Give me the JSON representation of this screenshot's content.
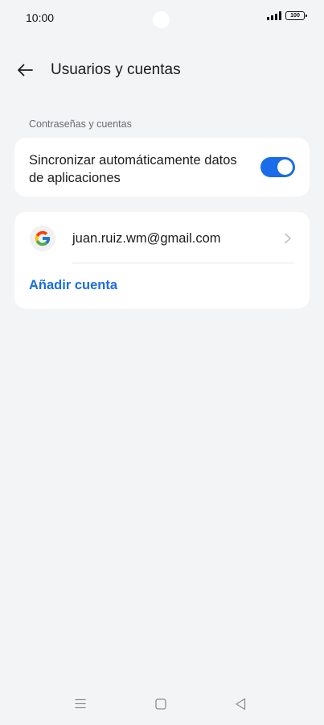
{
  "status_bar": {
    "time": "10:00",
    "battery": "100",
    "icons": [
      "signal-icon",
      "battery-icon"
    ]
  },
  "header": {
    "title": "Usuarios y cuentas",
    "back_icon": "arrow-left-icon"
  },
  "section": {
    "label": "Contraseñas y cuentas"
  },
  "sync": {
    "label": "Sincronizar automáticamente datos de aplicaciones",
    "toggle_on": true
  },
  "accounts": {
    "items": [
      {
        "email": "juan.ruiz.wm@gmail.com",
        "icon": "google-icon"
      }
    ],
    "add_label": "Añadir cuenta"
  },
  "nav": {
    "icons": [
      "menu-icon",
      "home-icon",
      "back-icon"
    ]
  },
  "colors": {
    "accent": "#1a6ce8",
    "background": "#f3f4f6",
    "card": "#ffffff",
    "text": "#1c1c1e",
    "secondary_text": "#6b6b70"
  }
}
